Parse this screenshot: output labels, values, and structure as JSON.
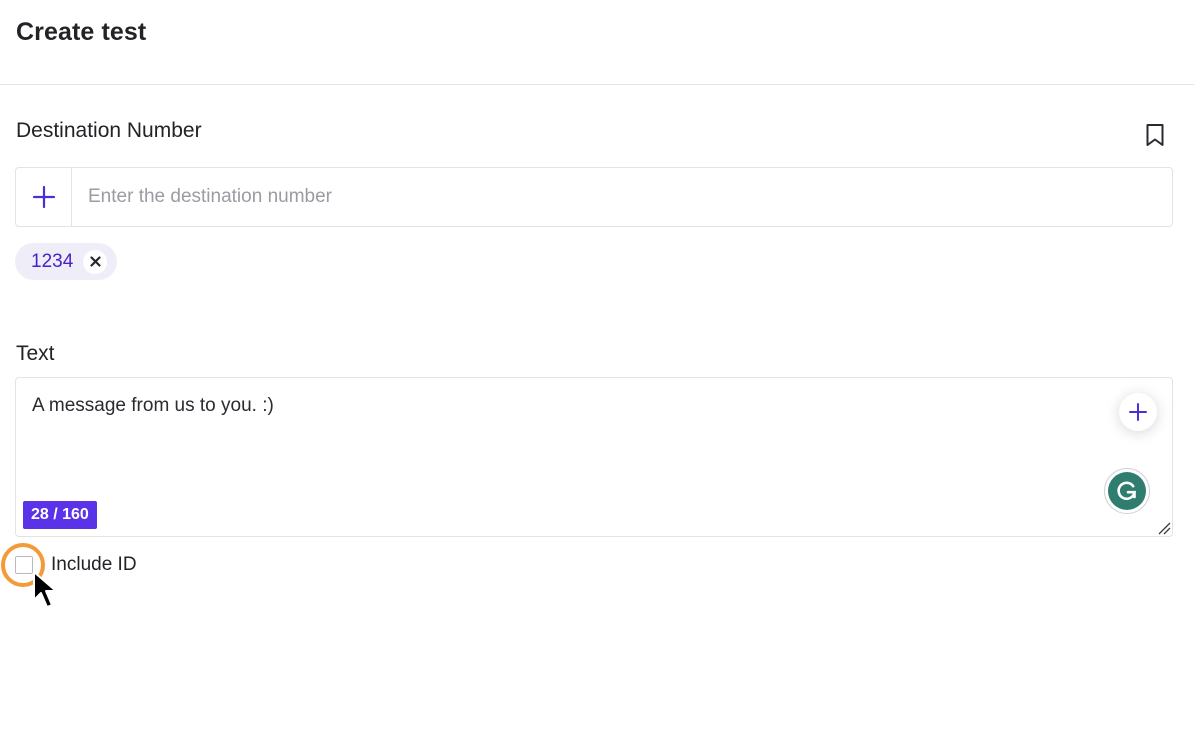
{
  "header": {
    "title": "Create test"
  },
  "destination": {
    "label": "Destination Number",
    "input_placeholder": "Enter the destination number",
    "input_value": "",
    "chips": [
      "1234"
    ]
  },
  "text": {
    "label": "Text",
    "message": "A message from us to you. :)",
    "counter": "28 / 160"
  },
  "options": {
    "include_id_label": "Include ID",
    "include_id_checked": false
  },
  "colors": {
    "accent": "#5a33e8",
    "chip_text": "#4b22c9",
    "chip_bg": "#efeef8",
    "focus_ring": "#f29b38",
    "grammarly": "#2e7d6f"
  },
  "icons": {
    "bookmark": "bookmark-icon",
    "add": "plus-icon",
    "remove": "close-icon",
    "grammarly": "grammarly-icon",
    "cursor": "mouse-pointer-icon"
  }
}
